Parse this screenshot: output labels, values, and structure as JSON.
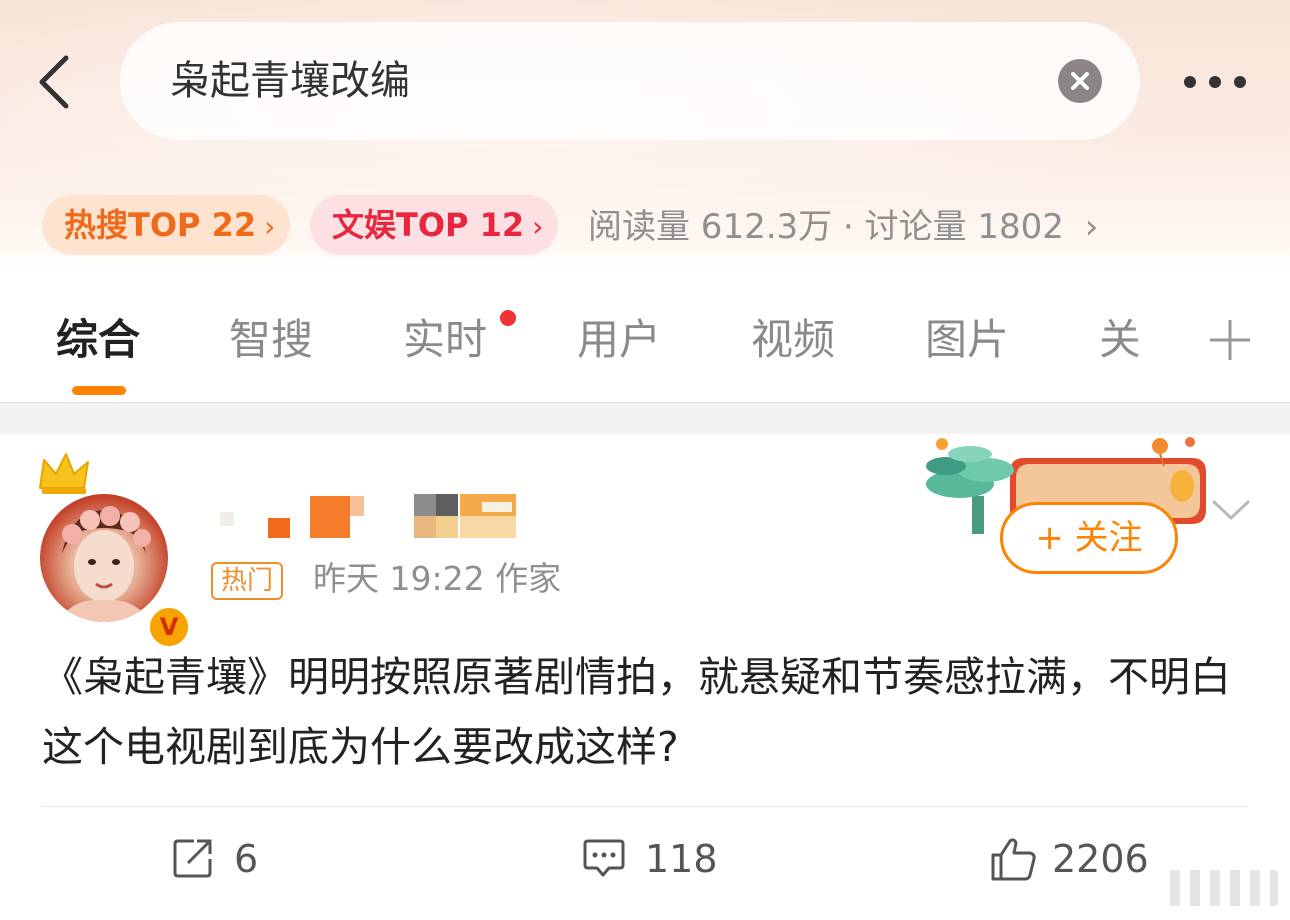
{
  "search": {
    "query": "枭起青壤改编"
  },
  "badges": {
    "hot": "热搜TOP 22",
    "entertainment": "文娱TOP 12",
    "chevron": "›"
  },
  "stats": {
    "text": "阅读量 612.3万 · 讨论量 1802",
    "chevron": "›"
  },
  "tabs": [
    {
      "label": "综合",
      "active": true
    },
    {
      "label": "智搜",
      "active": false
    },
    {
      "label": "实时",
      "active": false
    },
    {
      "label": "用户",
      "active": false
    },
    {
      "label": "视频",
      "active": false
    },
    {
      "label": "图片",
      "active": false
    },
    {
      "label": "关",
      "active": false
    }
  ],
  "post": {
    "verify_mark": "V",
    "hot_tag": "热门",
    "meta": "昨天 19:22  作家",
    "follow": "+ 关注",
    "text": "《枭起青壤》明明按照原著剧情拍，就悬疑和节奏感拉满，不明白这个电视剧到底为什么要改成这样?",
    "actions": {
      "reposts": "6",
      "comments": "118",
      "likes": "2206"
    }
  },
  "colors": {
    "accent": "#ff8200",
    "hot_badge": "#f06a1a",
    "ent_badge": "#e8263e",
    "dot": "#f03232"
  }
}
